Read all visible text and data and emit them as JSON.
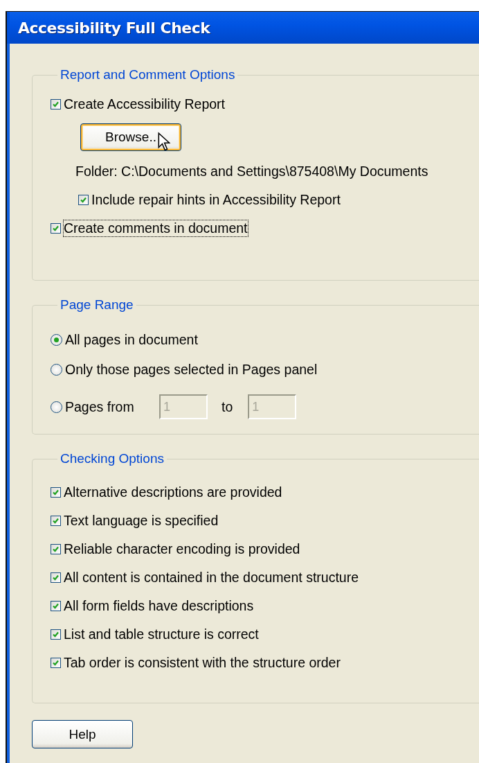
{
  "window": {
    "title": "Accessibility Full Check"
  },
  "report_group": {
    "title": "Report and Comment Options",
    "create_report": {
      "label": "Create Accessibility Report",
      "checked": true
    },
    "browse_button": {
      "label": "Browse.."
    },
    "folder": "Folder: C:\\Documents and Settings\\875408\\My Documents",
    "repair_hints": {
      "label": "Include repair hints in Accessibility Report",
      "checked": true
    },
    "create_comments": {
      "label": "Create comments in document",
      "checked": true,
      "focused": true
    }
  },
  "page_range": {
    "title": "Page Range",
    "options": [
      {
        "label": "All pages in document",
        "selected": true
      },
      {
        "label": "Only those pages selected in Pages panel",
        "selected": false
      },
      {
        "label": "Pages from",
        "selected": false
      }
    ],
    "from": {
      "value": "1",
      "disabled": true
    },
    "to_label": "to",
    "to": {
      "value": "1",
      "disabled": true
    }
  },
  "checking_options": {
    "title": "Checking Options",
    "items": [
      {
        "label": "Alternative descriptions are provided",
        "checked": true
      },
      {
        "label": "Text language is specified",
        "checked": true
      },
      {
        "label": "Reliable character encoding is provided",
        "checked": true
      },
      {
        "label": "All content is contained in the document structure",
        "checked": true
      },
      {
        "label": "All form fields have descriptions",
        "checked": true
      },
      {
        "label": "List and table structure is correct",
        "checked": true
      },
      {
        "label": "Tab order is consistent with the structure order",
        "checked": true
      }
    ]
  },
  "buttons": [
    {
      "label": "Help"
    }
  ]
}
